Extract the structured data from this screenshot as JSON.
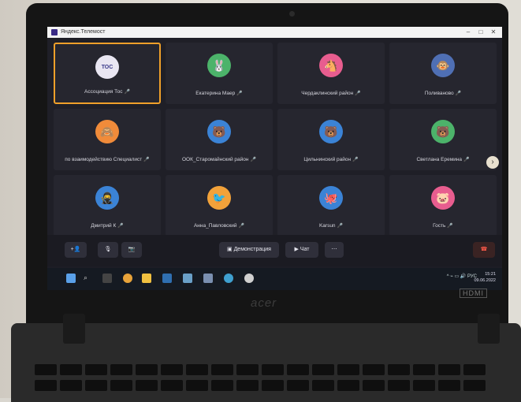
{
  "window": {
    "title": "Яндекс.Телемост",
    "controls": [
      "–",
      "□",
      "✕"
    ]
  },
  "participants": [
    {
      "name": "Ассоциация Тос",
      "avatar_text": "ТОС",
      "color": "#e9e6f2",
      "active": true
    },
    {
      "name": "Екатерина Маер",
      "avatar_text": "",
      "color": "#4cb36a",
      "active": false
    },
    {
      "name": "Чердаклинский район",
      "avatar_text": "",
      "color": "#e85d8f",
      "active": false
    },
    {
      "name": "Поливаново",
      "avatar_text": "",
      "color": "#4f6fb4",
      "active": false
    },
    {
      "name": "по взаимодействию Специалист",
      "avatar_text": "",
      "color": "#f08b3a",
      "active": false
    },
    {
      "name": "ООК_Старомайнский район",
      "avatar_text": "",
      "color": "#3b83d6",
      "active": false
    },
    {
      "name": "Цильнинский район",
      "avatar_text": "",
      "color": "#3b83d6",
      "active": false
    },
    {
      "name": "Светлана Еремина",
      "avatar_text": "",
      "color": "#4cb36a",
      "active": false
    },
    {
      "name": "Дмитрий К",
      "avatar_text": "",
      "color": "#3b83d6",
      "active": false
    },
    {
      "name": "Анна_Павловский",
      "avatar_text": "",
      "color": "#f2a23a",
      "active": false
    },
    {
      "name": "Karsun",
      "avatar_text": "",
      "color": "#3b83d6",
      "active": false
    },
    {
      "name": "Гость",
      "avatar_text": "",
      "color": "#e85d8f",
      "active": false
    }
  ],
  "controls_bar": {
    "demo_label": "Демонстрация",
    "chat_label": "Чат",
    "more_label": "⋯"
  },
  "taskbar": {
    "lang": "РУС",
    "time": "15:21",
    "date": "09.06.2022"
  },
  "brand": "acer",
  "port_label": "HDMI"
}
